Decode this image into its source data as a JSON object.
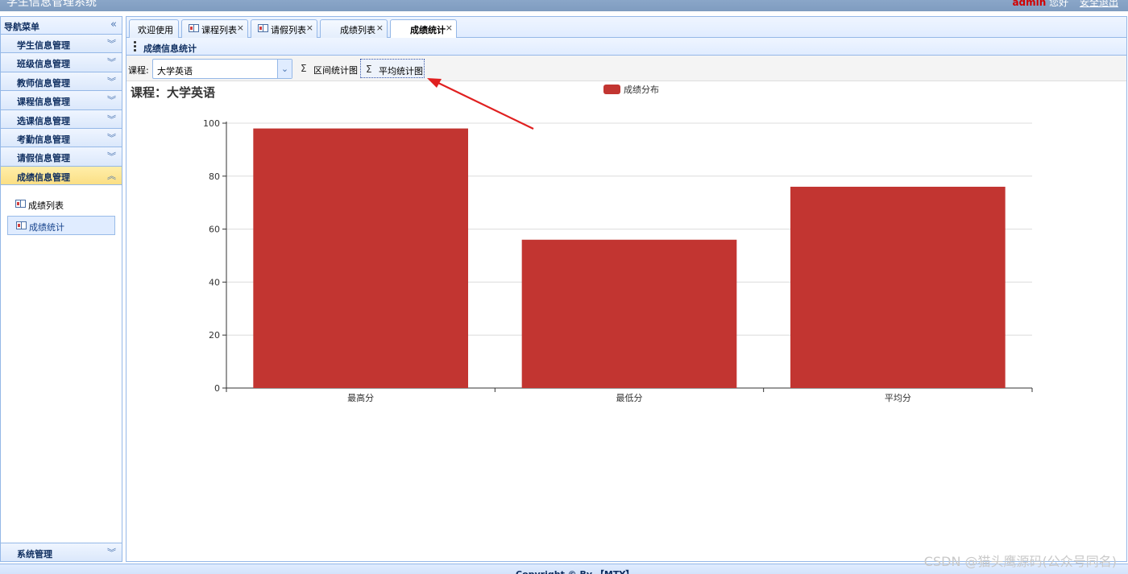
{
  "header": {
    "title": "学生信息管理系统",
    "user_name": "admin",
    "greeting": "您好",
    "logout": "安全退出"
  },
  "sidebar": {
    "title": "导航菜单",
    "items": [
      {
        "label": "学生信息管理"
      },
      {
        "label": "班级信息管理"
      },
      {
        "label": "教师信息管理"
      },
      {
        "label": "课程信息管理"
      },
      {
        "label": "选课信息管理"
      },
      {
        "label": "考勤信息管理"
      },
      {
        "label": "请假信息管理"
      },
      {
        "label": "成绩信息管理"
      }
    ],
    "sub_items": [
      {
        "label": "成绩列表"
      },
      {
        "label": "成绩统计"
      }
    ],
    "system_item": "系统管理"
  },
  "tabs": [
    {
      "label": "欢迎使用"
    },
    {
      "label": "课程列表"
    },
    {
      "label": "请假列表"
    },
    {
      "label": "成绩列表"
    },
    {
      "label": "成绩统计"
    }
  ],
  "panel": {
    "title": "成绩信息统计"
  },
  "toolbar": {
    "course_label": "课程:",
    "course_value": "大学英语",
    "range_chart_btn": "区间统计图",
    "avg_chart_btn": "平均统计图"
  },
  "chart_data": {
    "type": "bar",
    "title": "课程：大学英语",
    "categories": [
      "最高分",
      "最低分",
      "平均分"
    ],
    "series": [
      {
        "name": "成绩分布",
        "values": [
          98,
          56,
          76
        ]
      }
    ],
    "ylim": [
      0,
      100
    ],
    "yticks": [
      0,
      20,
      40,
      60,
      80,
      100
    ],
    "grid": true,
    "legend": "top-center",
    "bar_color": "#c23531"
  },
  "footer": {
    "text": "Copyright © By 【MTY】"
  },
  "watermark": "CSDN @猫头鹰源码(公众号同名)",
  "colors": {
    "annotation_arrow": "#e02020"
  }
}
